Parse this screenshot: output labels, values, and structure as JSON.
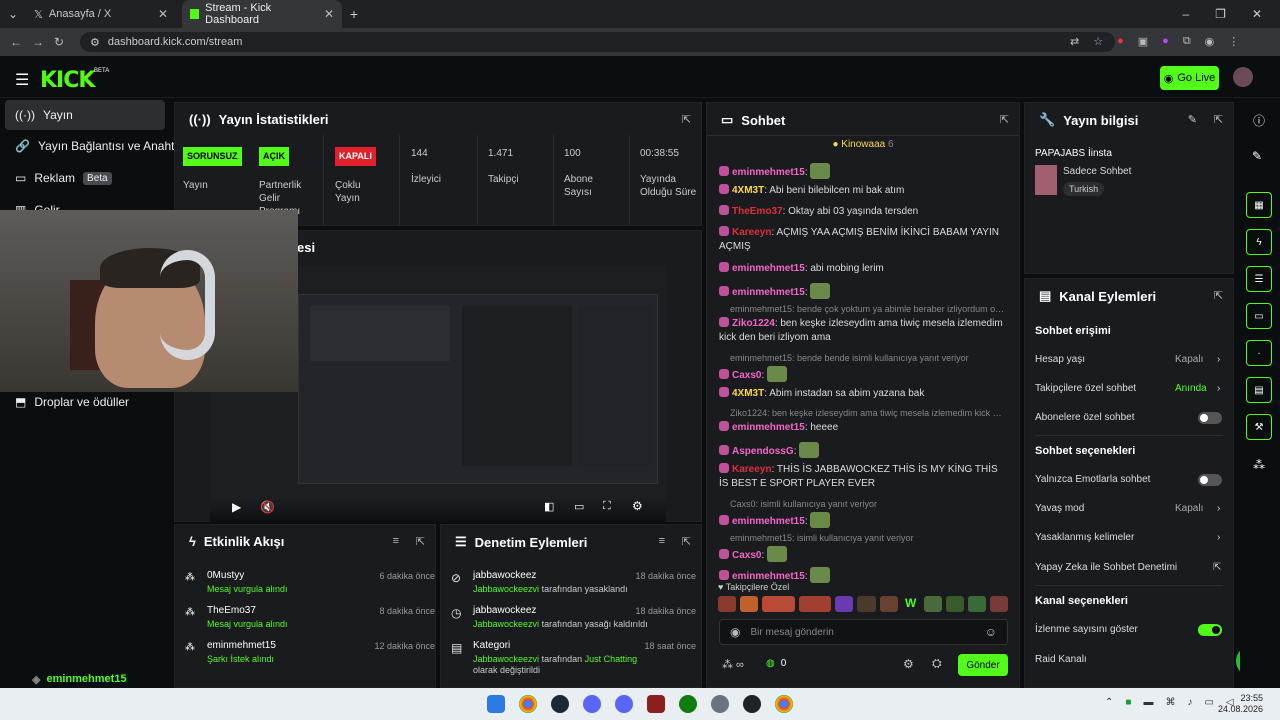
{
  "browser": {
    "tabs": [
      {
        "label": "Anasayfa / X",
        "active": false
      },
      {
        "label": "Stream - Kick Dashboard",
        "active": true
      }
    ],
    "url": "dashboard.kick.com/stream"
  },
  "header": {
    "logo": "KICK",
    "logo_badge": "BETA",
    "go_live": "Go Live"
  },
  "sidebar": {
    "items": [
      {
        "label": "Yayın",
        "active": true
      },
      {
        "label": "Yayın Bağlantısı ve Anahtar"
      },
      {
        "label": "Reklam",
        "badge": "Beta"
      },
      {
        "label": "Gelir"
      },
      {
        "label": "Droplar ve ödüller"
      }
    ],
    "bottom_user": "eminmehmet15"
  },
  "stats": {
    "title": "Yayın İstatistikleri",
    "items": [
      {
        "value": "SORUNSUZ",
        "label": "Yayın",
        "color": "#53fc18"
      },
      {
        "value": "AÇIK",
        "label": "Partnerlik Gelir Programı",
        "color": "#53fc18"
      },
      {
        "value": "KAPALI",
        "label": "Çoklu Yayın",
        "color": "#e0202a"
      },
      {
        "value": "144",
        "label": "İzleyici"
      },
      {
        "value": "1.471",
        "label": "Takipçi"
      },
      {
        "value": "100",
        "label": "Abone Sayısı"
      },
      {
        "value": "00:38:55",
        "label": "Yayında Olduğu Süre"
      }
    ]
  },
  "preview": {
    "title_partial": "esi"
  },
  "activity": {
    "title": "Etkinlik Akışı",
    "items": [
      {
        "name": "0Mustyy",
        "desc": "Mesaj vurgula alındı",
        "time": "6 dakika önce"
      },
      {
        "name": "TheEmo37",
        "desc": "Mesaj vurgula alındı",
        "time": "8 dakika önce"
      },
      {
        "name": "eminmehmet15",
        "desc": "Şarkı İstek alındı",
        "time": "12 dakika önce"
      }
    ]
  },
  "moderation": {
    "title": "Denetim Eylemleri",
    "items": [
      {
        "name": "jabbawockeez",
        "desc_user": "Jabbawockeezvi",
        "desc": "tarafından yasaklandı",
        "time": "18 dakika önce"
      },
      {
        "name": "jabbawockeez",
        "desc_user": "Jabbawockeezvi",
        "desc": "tarafından yasağı kaldırıldı",
        "time": "18 dakika önce"
      },
      {
        "name": "Kategori",
        "desc_user": "Jabbawockeezvi",
        "desc": "tarafından",
        "desc2": "Just Chatting",
        "desc3": "olarak değiştirildi",
        "time": "18 saat önce"
      }
    ]
  },
  "chat": {
    "title": "Sohbet",
    "pinned_user": "Kinowaaa",
    "pinned_count": "6",
    "messages": [
      {
        "user": "eminmehmet15",
        "color": "#f565c8",
        "text": ""
      },
      {
        "user": "4XM3T",
        "color": "#fbda3e",
        "text": "Abi beni bilebilcen mi bak atım"
      },
      {
        "user": "TheEmo37",
        "color": "#e02f3a",
        "text": "Oktay abi 03 yaşında tersden"
      },
      {
        "user": "Kareeyn",
        "color": "#e02f3a",
        "text": "AÇMIŞ YAA AÇMIŞ BENİM İKİNCİ BABAM YAYIN AÇMIŞ"
      },
      {
        "user": "eminmehmet15",
        "color": "#f565c8",
        "text": "abi mobing lerim"
      },
      {
        "user": "eminmehmet15",
        "color": "#f565c8",
        "text": ""
      },
      {
        "reply": "eminmehmet15: bende çok yoktum ya abimle beraber izliyordum o zaman..."
      },
      {
        "user": "Ziko1224",
        "color": "#f565c8",
        "text": "ben keşke izleseydim ama tiwiç mesela izlemedim kick den beri izliyom ama"
      },
      {
        "reply": "eminmehmet15: bende bende isimli kullanıcıya yanıt veriyor"
      },
      {
        "user": "Caxs0",
        "color": "#f565c8",
        "text": ""
      },
      {
        "user": "4XM3T",
        "color": "#fbda3e",
        "text": "Abim instadan sa abim yazana bak"
      },
      {
        "reply": "Ziko1224: ben keşke izleseydim ama tiwiç mesela izlemedim kick de..."
      },
      {
        "user": "eminmehmet15",
        "color": "#f565c8",
        "text": "heeee"
      },
      {
        "user": "AspendossG",
        "color": "#f565c8",
        "text": ""
      },
      {
        "user": "Kareeyn",
        "color": "#e02f3a",
        "text": "THİS İS JABBAWOCKEZ THİS İS MY KİNG THİS İS BEST E SPORT PLAYER EVER"
      },
      {
        "reply": "Caxs0: isimli kullanıcıya yanıt veriyor"
      },
      {
        "user": "eminmehmet15",
        "color": "#f565c8",
        "text": ""
      },
      {
        "reply": "eminmehmet15: isimli kullanıcıya yanıt veriyor"
      },
      {
        "user": "Caxs0",
        "color": "#f565c8",
        "text": ""
      },
      {
        "user": "eminmehmet15",
        "color": "#f565c8",
        "text": ""
      }
    ],
    "followers_only": "Takipçilere Özel",
    "input_placeholder": "Bir mesaj gönderin",
    "points": "0",
    "send": "Gönder"
  },
  "stream_info": {
    "title": "Yayın bilgisi",
    "stream_name": "PAPAJABS İinsta",
    "chat_mode": "Sadece Sohbet",
    "tag": "Turkish"
  },
  "channel_actions": {
    "title": "Kanal Eylemleri",
    "chat_access": "Sohbet erişimi",
    "account_age": {
      "label": "Hesap yaşı",
      "value": "Kapalı"
    },
    "followers_chat": {
      "label": "Takipçilere özel sohbet",
      "value": "Anında"
    },
    "subscribers_chat": {
      "label": "Abonelere özel sohbet",
      "on": false
    },
    "chat_options": "Sohbet seçenekleri",
    "emotes_only": {
      "label": "Yalnızca Emotlarla sohbet",
      "on": false
    },
    "slow_mode": {
      "label": "Yavaş mod",
      "value": "Kapalı"
    },
    "banned_words": "Yasaklanmış kelimeler",
    "ai_moderation": "Yapay Zeka ile Sohbet Denetimi",
    "channel_options": "Kanal seçenekleri",
    "show_viewers": {
      "label": "İzlenme sayısını göster",
      "on": true
    },
    "raid": "Raid Kanalı"
  },
  "taskbar": {
    "time": "23:55",
    "date": "24.08.2026"
  },
  "colors": {
    "accent": "#53fc18",
    "panel": "#191b1f",
    "bg": "#0b0e0f"
  }
}
